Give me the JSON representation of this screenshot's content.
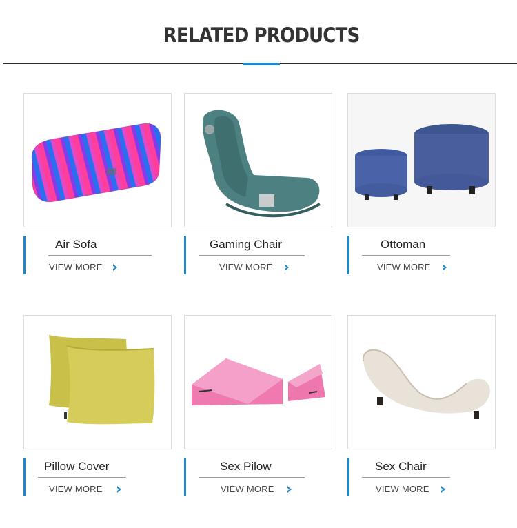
{
  "header": {
    "title": "RELATED PRODUCTS"
  },
  "accent_color": "#1e88c8",
  "products": [
    {
      "name": "Air Sofa",
      "link": "VIEW MORE",
      "image": "air-sofa-image"
    },
    {
      "name": "Gaming Chair",
      "link": "VIEW MORE",
      "image": "gaming-chair-image"
    },
    {
      "name": "Ottoman",
      "link": "VIEW MORE",
      "image": "ottoman-image"
    },
    {
      "name": "Pillow Cover",
      "link": "VIEW MORE",
      "image": "pillow-cover-image"
    },
    {
      "name": "Sex Pilow",
      "link": "VIEW MORE",
      "image": "sex-pillow-image"
    },
    {
      "name": "Sex Chair",
      "link": "VIEW MORE",
      "image": "sex-chair-image"
    }
  ],
  "icons": {
    "more": "chevron-right-icon"
  }
}
